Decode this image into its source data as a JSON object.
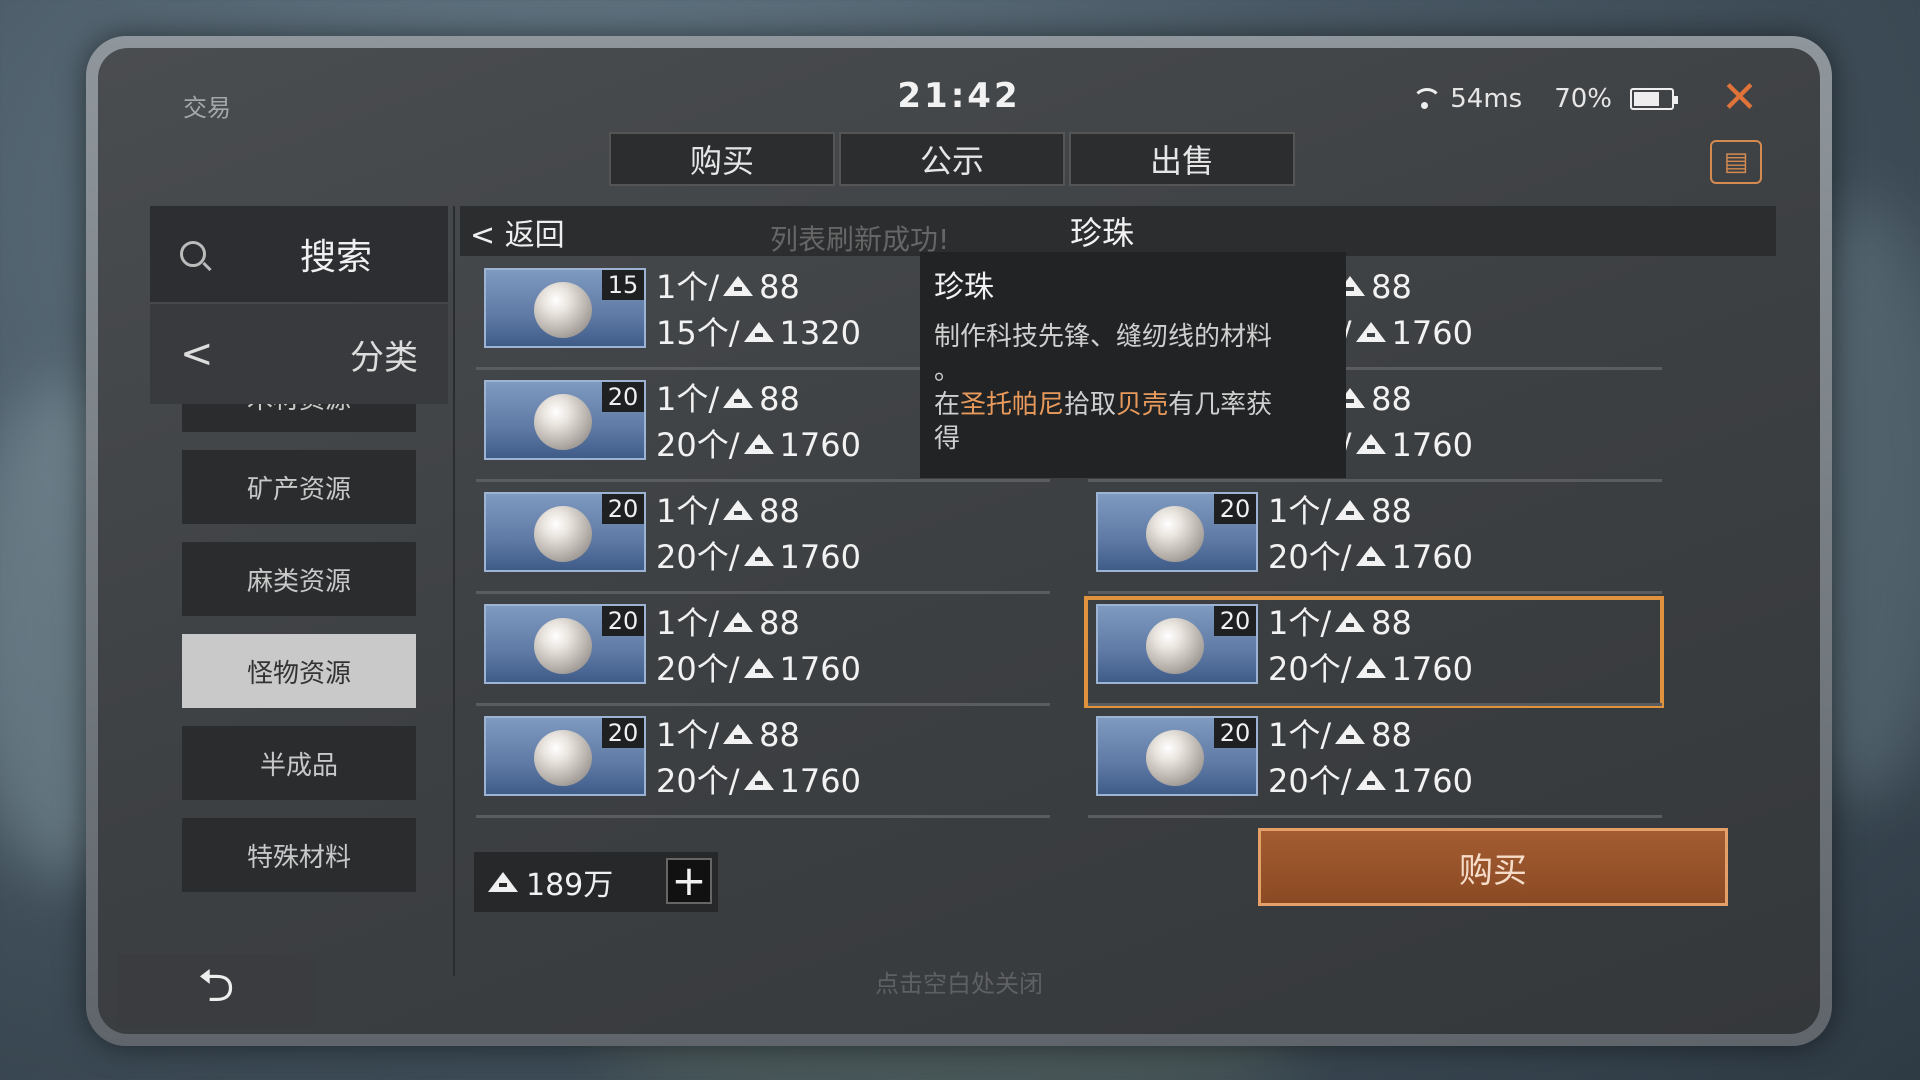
{
  "window": {
    "title": "交易",
    "clock": "21:42",
    "ping": "54ms",
    "battery": "70%",
    "battery_level": 0.7
  },
  "tabs": [
    {
      "label": "购买",
      "active": true
    },
    {
      "label": "公示",
      "active": false
    },
    {
      "label": "出售",
      "active": false
    }
  ],
  "sidebar": {
    "search_label": "搜索",
    "category_label": "分类",
    "items": [
      {
        "label": "木材资源",
        "active": false
      },
      {
        "label": "矿产资源",
        "active": false
      },
      {
        "label": "麻类资源",
        "active": false
      },
      {
        "label": "怪物资源",
        "active": true
      },
      {
        "label": "半成品",
        "active": false
      },
      {
        "label": "特殊材料",
        "active": false
      }
    ]
  },
  "header": {
    "back_label": "返回",
    "toast": "列表刷新成功!",
    "category_title": "珍珠"
  },
  "listings": [
    {
      "qty": "15",
      "unit_price": "1个/",
      "unit_value": "88",
      "total_prefix": "15个/",
      "total_value": "1320",
      "selected": false
    },
    {
      "qty": "20",
      "unit_price": "1个/",
      "unit_value": "88",
      "total_prefix": "20个/",
      "total_value": "1760",
      "selected": false
    },
    {
      "qty": "20",
      "unit_price": "1个/",
      "unit_value": "88",
      "total_prefix": "20个/",
      "total_value": "1760",
      "selected": false
    },
    {
      "qty": "20",
      "unit_price": "1个/",
      "unit_value": "88",
      "total_prefix": "20个/",
      "total_value": "1760",
      "selected": false
    },
    {
      "qty": "20",
      "unit_price": "1个/",
      "unit_value": "88",
      "total_prefix": "20个/",
      "total_value": "1760",
      "selected": false
    },
    {
      "qty": "20",
      "unit_price": "1个/",
      "unit_value": "88",
      "total_prefix": "20个/",
      "total_value": "1760",
      "selected": false
    },
    {
      "qty": "20",
      "unit_price": "1个/",
      "unit_value": "88",
      "total_prefix": "20个/",
      "total_value": "1760",
      "selected": false
    },
    {
      "qty": "20",
      "unit_price": "1个/",
      "unit_value": "88",
      "total_prefix": "20个/",
      "total_value": "1760",
      "selected": true
    },
    {
      "qty": "20",
      "unit_price": "1个/",
      "unit_value": "88",
      "total_prefix": "20个/",
      "total_value": "1760",
      "selected": false
    },
    {
      "qty": "20",
      "unit_price": "1个/",
      "unit_value": "88",
      "total_prefix": "20个/",
      "total_value": "1760",
      "selected": false
    }
  ],
  "tooltip": {
    "title": "珍珠",
    "line1": "制作科技先锋、缝纫线的材料",
    "line1b": "。",
    "line2_pre": "在",
    "line2_hl1": "圣托帕尼",
    "line2_mid": "拾取",
    "line2_hl2": "贝壳",
    "line2_post": "有几率获",
    "line3": "得"
  },
  "footer": {
    "money": "189万",
    "plus": "+",
    "buy_label": "购买",
    "hint": "点击空白处关闭"
  },
  "colors": {
    "accent": "#e0923c",
    "highlight": "#e89a5c",
    "close": "#e0733a"
  },
  "icons": {
    "close": "close-icon",
    "search": "search-icon",
    "back": "back-arrow-icon",
    "coin": "currency-icon",
    "clipboard": "clipboard-icon"
  }
}
